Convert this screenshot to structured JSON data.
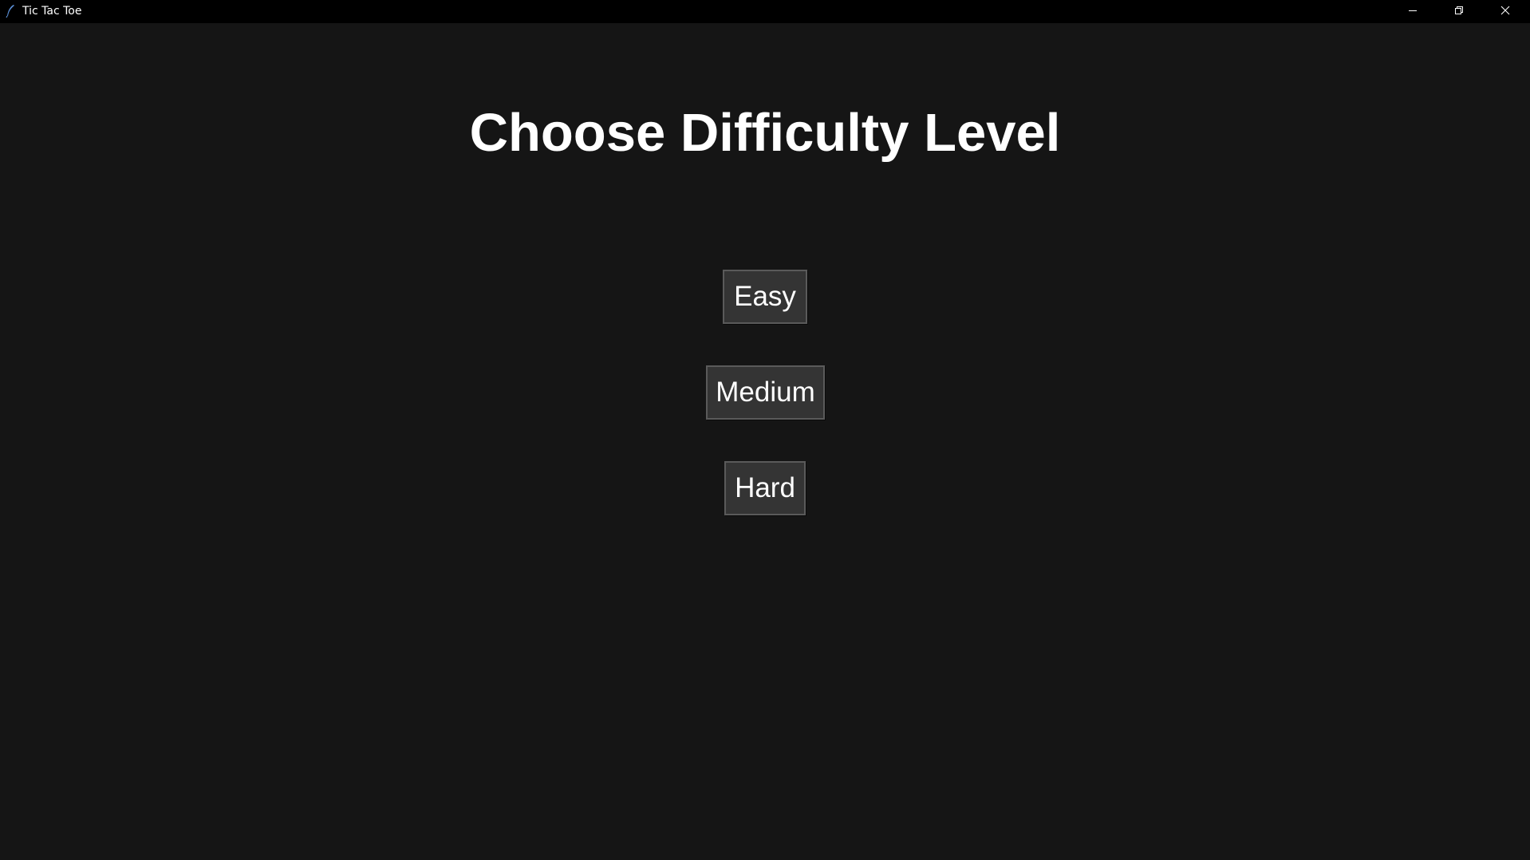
{
  "window": {
    "title": "Tic Tac Toe",
    "icon": "feather-icon",
    "controls": {
      "minimize_icon": "minimize-icon",
      "restore_icon": "restore-icon",
      "close_icon": "close-icon"
    }
  },
  "main": {
    "heading": "Choose Difficulty Level",
    "buttons": {
      "easy": "Easy",
      "medium": "Medium",
      "hard": "Hard"
    }
  },
  "colors": {
    "titlebar_bg": "#000000",
    "window_bg": "#151515",
    "button_bg": "#343434",
    "button_border": "#5a5a5a",
    "text": "#ffffff"
  }
}
